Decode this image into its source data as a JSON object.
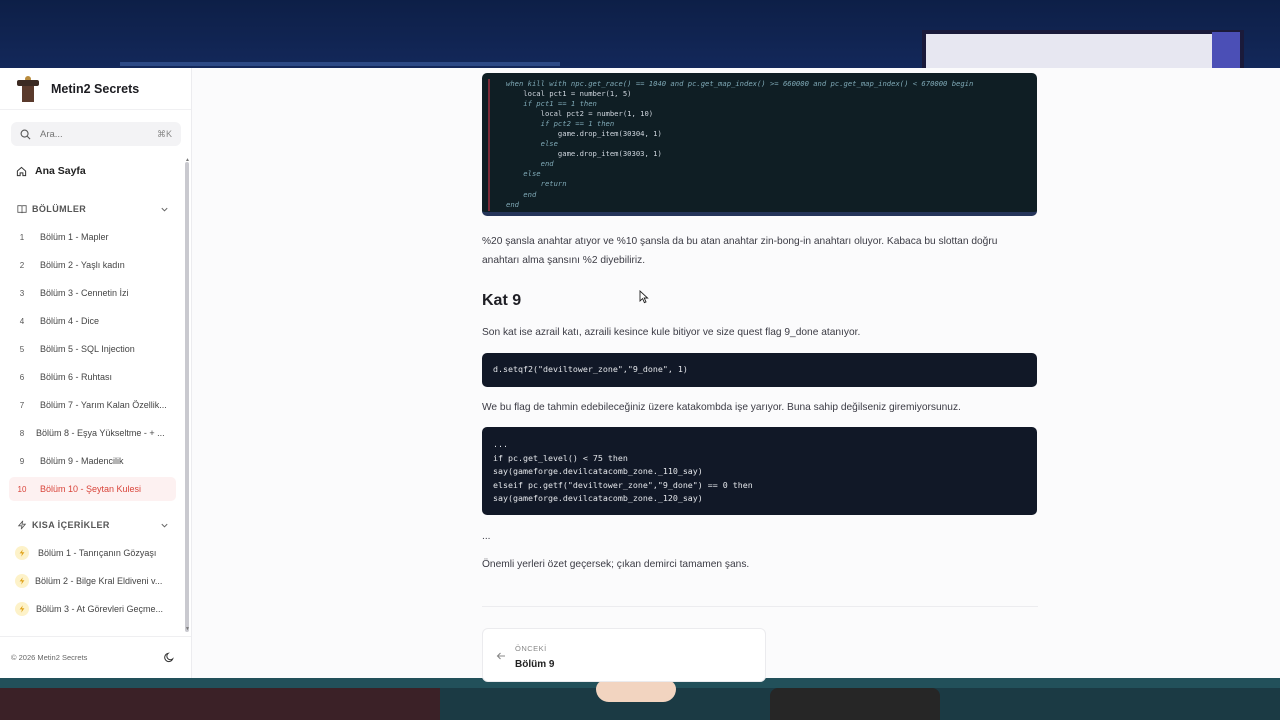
{
  "brand": {
    "title": "Metin2 Secrets"
  },
  "search": {
    "placeholder": "Ara...",
    "shortcut": "⌘K"
  },
  "nav": {
    "home_label": "Ana Sayfa"
  },
  "sections": {
    "chapters": {
      "title": "BÖLÜMLER",
      "items": [
        {
          "num": "1",
          "label": "Bölüm 1 - Mapler"
        },
        {
          "num": "2",
          "label": "Bölüm 2 - Yaşlı kadın"
        },
        {
          "num": "3",
          "label": "Bölüm 3 - Cennetin İzi"
        },
        {
          "num": "4",
          "label": "Bölüm 4 - Dice"
        },
        {
          "num": "5",
          "label": "Bölüm 5 - SQL Injection"
        },
        {
          "num": "6",
          "label": "Bölüm 6 - Ruhtası"
        },
        {
          "num": "7",
          "label": "Bölüm 7 - Yarım Kalan Özellik..."
        },
        {
          "num": "8",
          "label": "Bölüm 8 - Eşya Yükseltme - + ..."
        },
        {
          "num": "9",
          "label": "Bölüm 9 - Madencilik"
        },
        {
          "num": "10",
          "label": "Bölüm 10 - Şeytan Kulesi",
          "active": true
        }
      ]
    },
    "short": {
      "title": "KISA İÇERİKLER",
      "items": [
        {
          "label": "Bölüm 1 - Tanrıçanın Gözyaşı"
        },
        {
          "label": "Bölüm 2 - Bilge Kral Eldiveni v..."
        },
        {
          "label": "Bölüm 3 - At Görevleri Geçme..."
        }
      ]
    }
  },
  "footer": {
    "copyright": "© 2026 Metin2 Secrets"
  },
  "article": {
    "code1_lines": [
      "when kill with npc.get_race() == 1040 and pc.get_map_index() >= 660000 and pc.get_map_index() < 670000 begin",
      "    local pct1 = number(1, 5)",
      "    if pct1 == 1 then",
      "        local pct2 = number(1, 10)",
      "        if pct2 == 1 then",
      "            game.drop_item(30304, 1)",
      "        else",
      "            game.drop_item(30303, 1)",
      "        end",
      "    else",
      "        return",
      "    end",
      "end"
    ],
    "para1": "%20 şansla anahtar atıyor ve %10 şansla da bu atan anahtar zin-bong-in anahtarı oluyor. Kabaca bu slottan doğru anahtarı alma şansını %2 diyebiliriz.",
    "heading": "Kat 9",
    "para2": "Son kat ise azrail katı, azraili kesince kule bitiyor ve size quest flag 9_done atanıyor.",
    "code2": "d.setqf2(\"deviltower_zone\",\"9_done\", 1)",
    "para3": "We bu flag de tahmin edebileceğiniz üzere katakombda işe yarıyor. Buna sahip değilseniz giremiyorsunuz.",
    "code3_lines": [
      "...",
      "if pc.get_level() < 75 then",
      "say(gameforge.devilcatacomb_zone._110_say)",
      "elseif pc.getf(\"deviltower_zone\",\"9_done\") == 0 then",
      "say(gameforge.devilcatacomb_zone._120_say)"
    ],
    "ellipsis": "...",
    "para4": "Önemli yerleri özet geçersek; çıkan demirci tamamen şans."
  },
  "pager": {
    "prev_caption": "ÖNCEKİ",
    "prev_title": "Bölüm 9"
  }
}
